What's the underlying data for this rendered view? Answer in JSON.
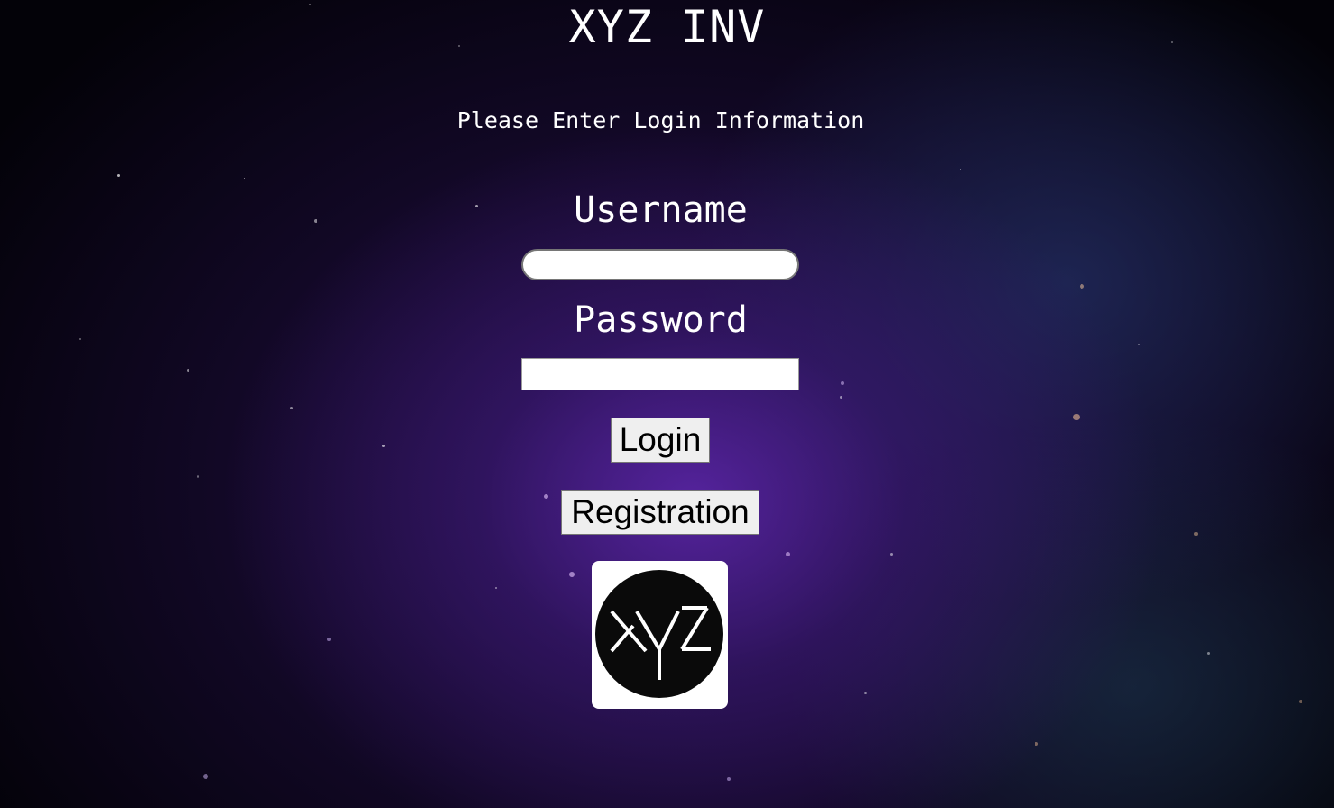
{
  "page": {
    "title": "XYZ INV",
    "subtitle": "Please Enter Login Information"
  },
  "form": {
    "username_label": "Username",
    "username_value": "",
    "password_label": "Password",
    "password_value": "",
    "login_label": "Login",
    "register_label": "Registration"
  },
  "logo": {
    "icon": "xyz-logo-icon",
    "letters": "XYZ"
  },
  "colors": {
    "text": "#ffffff",
    "background_center": "#5c26aa",
    "background_edge": "#030208",
    "button_bg": "#efefef"
  }
}
